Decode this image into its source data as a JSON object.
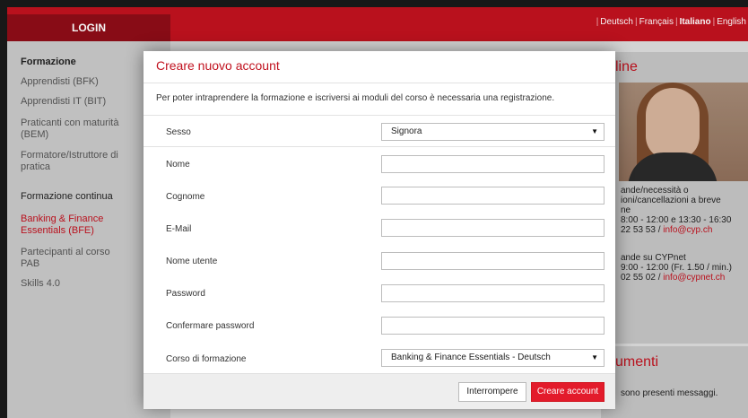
{
  "header": {
    "login_label": "LOGIN",
    "languages": [
      "Deutsch",
      "Français",
      "Italiano",
      "English"
    ],
    "active_language": "Italiano"
  },
  "sidebar": {
    "section1_title": "Formazione",
    "section1_items": [
      "Apprendisti (BFK)",
      "Apprendisti IT (BIT)",
      "Praticanti con maturità (BEM)",
      "Formatore/Istruttore di pratica"
    ],
    "section2_title": "Formazione continua",
    "section2_items": [
      "Banking & Finance Essentials (BFE)",
      "Partecipanti al corso PAB",
      "Skills 4.0"
    ]
  },
  "right_panel": {
    "title_partial": "line",
    "block1": [
      "ande/necessità o",
      "ioni/cancellazioni a breve",
      "ne",
      "8:00 - 12:00 e 13:30 - 16:30"
    ],
    "block1_phone": "22 53 53 /",
    "block1_email": "info@cyp.ch",
    "block2": [
      "ande su CYPnet",
      "9:00 - 12:00 (Fr. 1.50 / min.)"
    ],
    "block2_phone": "02 55 02 /",
    "block2_email": "info@cypnet.ch",
    "docs_title_partial": "umenti",
    "docs_text_partial": "sono presenti messaggi."
  },
  "modal": {
    "title": "Creare nuovo account",
    "intro": "Per poter intraprendere la formazione e iscriversi ai moduli del corso è necessaria una registrazione.",
    "fields": {
      "gender_label": "Sesso",
      "gender_value": "Signora",
      "first_name_label": "Nome",
      "last_name_label": "Cognome",
      "email_label": "E-Mail",
      "username_label": "Nome utente",
      "password_label": "Password",
      "confirm_label": "Confermare password",
      "course_label": "Corso di formazione",
      "course_value": "Banking & Finance Essentials - Deutsch"
    },
    "cancel_label": "Interrompere",
    "create_label": "Creare account"
  },
  "colors": {
    "brand_red": "#c1121f",
    "button_red": "#e31b2b"
  }
}
